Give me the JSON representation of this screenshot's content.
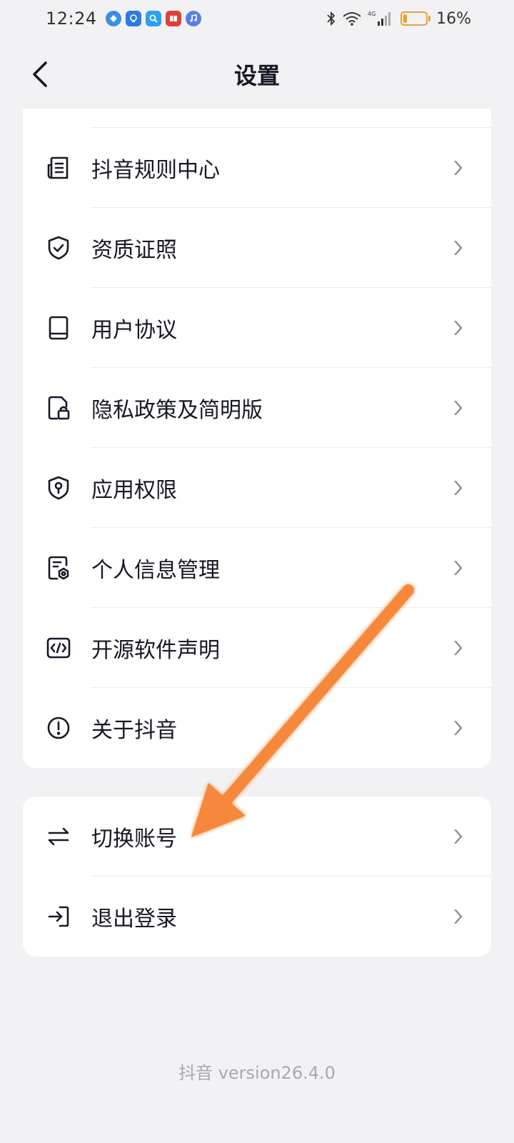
{
  "status_bar": {
    "time": "12:24",
    "battery_percent": "16%",
    "battery_level": 0.16,
    "network": "4G"
  },
  "header": {
    "title": "设置"
  },
  "group1": [
    {
      "label": "抖音规则中心",
      "icon": "document-list-icon"
    },
    {
      "label": "资质证照",
      "icon": "shield-check-icon"
    },
    {
      "label": "用户协议",
      "icon": "book-icon"
    },
    {
      "label": "隐私政策及简明版",
      "icon": "privacy-lock-icon"
    },
    {
      "label": "应用权限",
      "icon": "permission-shield-icon"
    },
    {
      "label": "个人信息管理",
      "icon": "personal-info-gear-icon"
    },
    {
      "label": "开源软件声明",
      "icon": "code-icon"
    },
    {
      "label": "关于抖音",
      "icon": "info-circle-icon"
    }
  ],
  "group2": [
    {
      "label": "切换账号",
      "icon": "switch-arrows-icon"
    },
    {
      "label": "退出登录",
      "icon": "logout-icon"
    }
  ],
  "footer": {
    "version": "抖音 version26.4.0"
  },
  "colors": {
    "background": "#f2f2f4",
    "card": "#ffffff",
    "text": "#161823",
    "muted": "#a8a9ad",
    "annotation_arrow": "#f5883a"
  }
}
